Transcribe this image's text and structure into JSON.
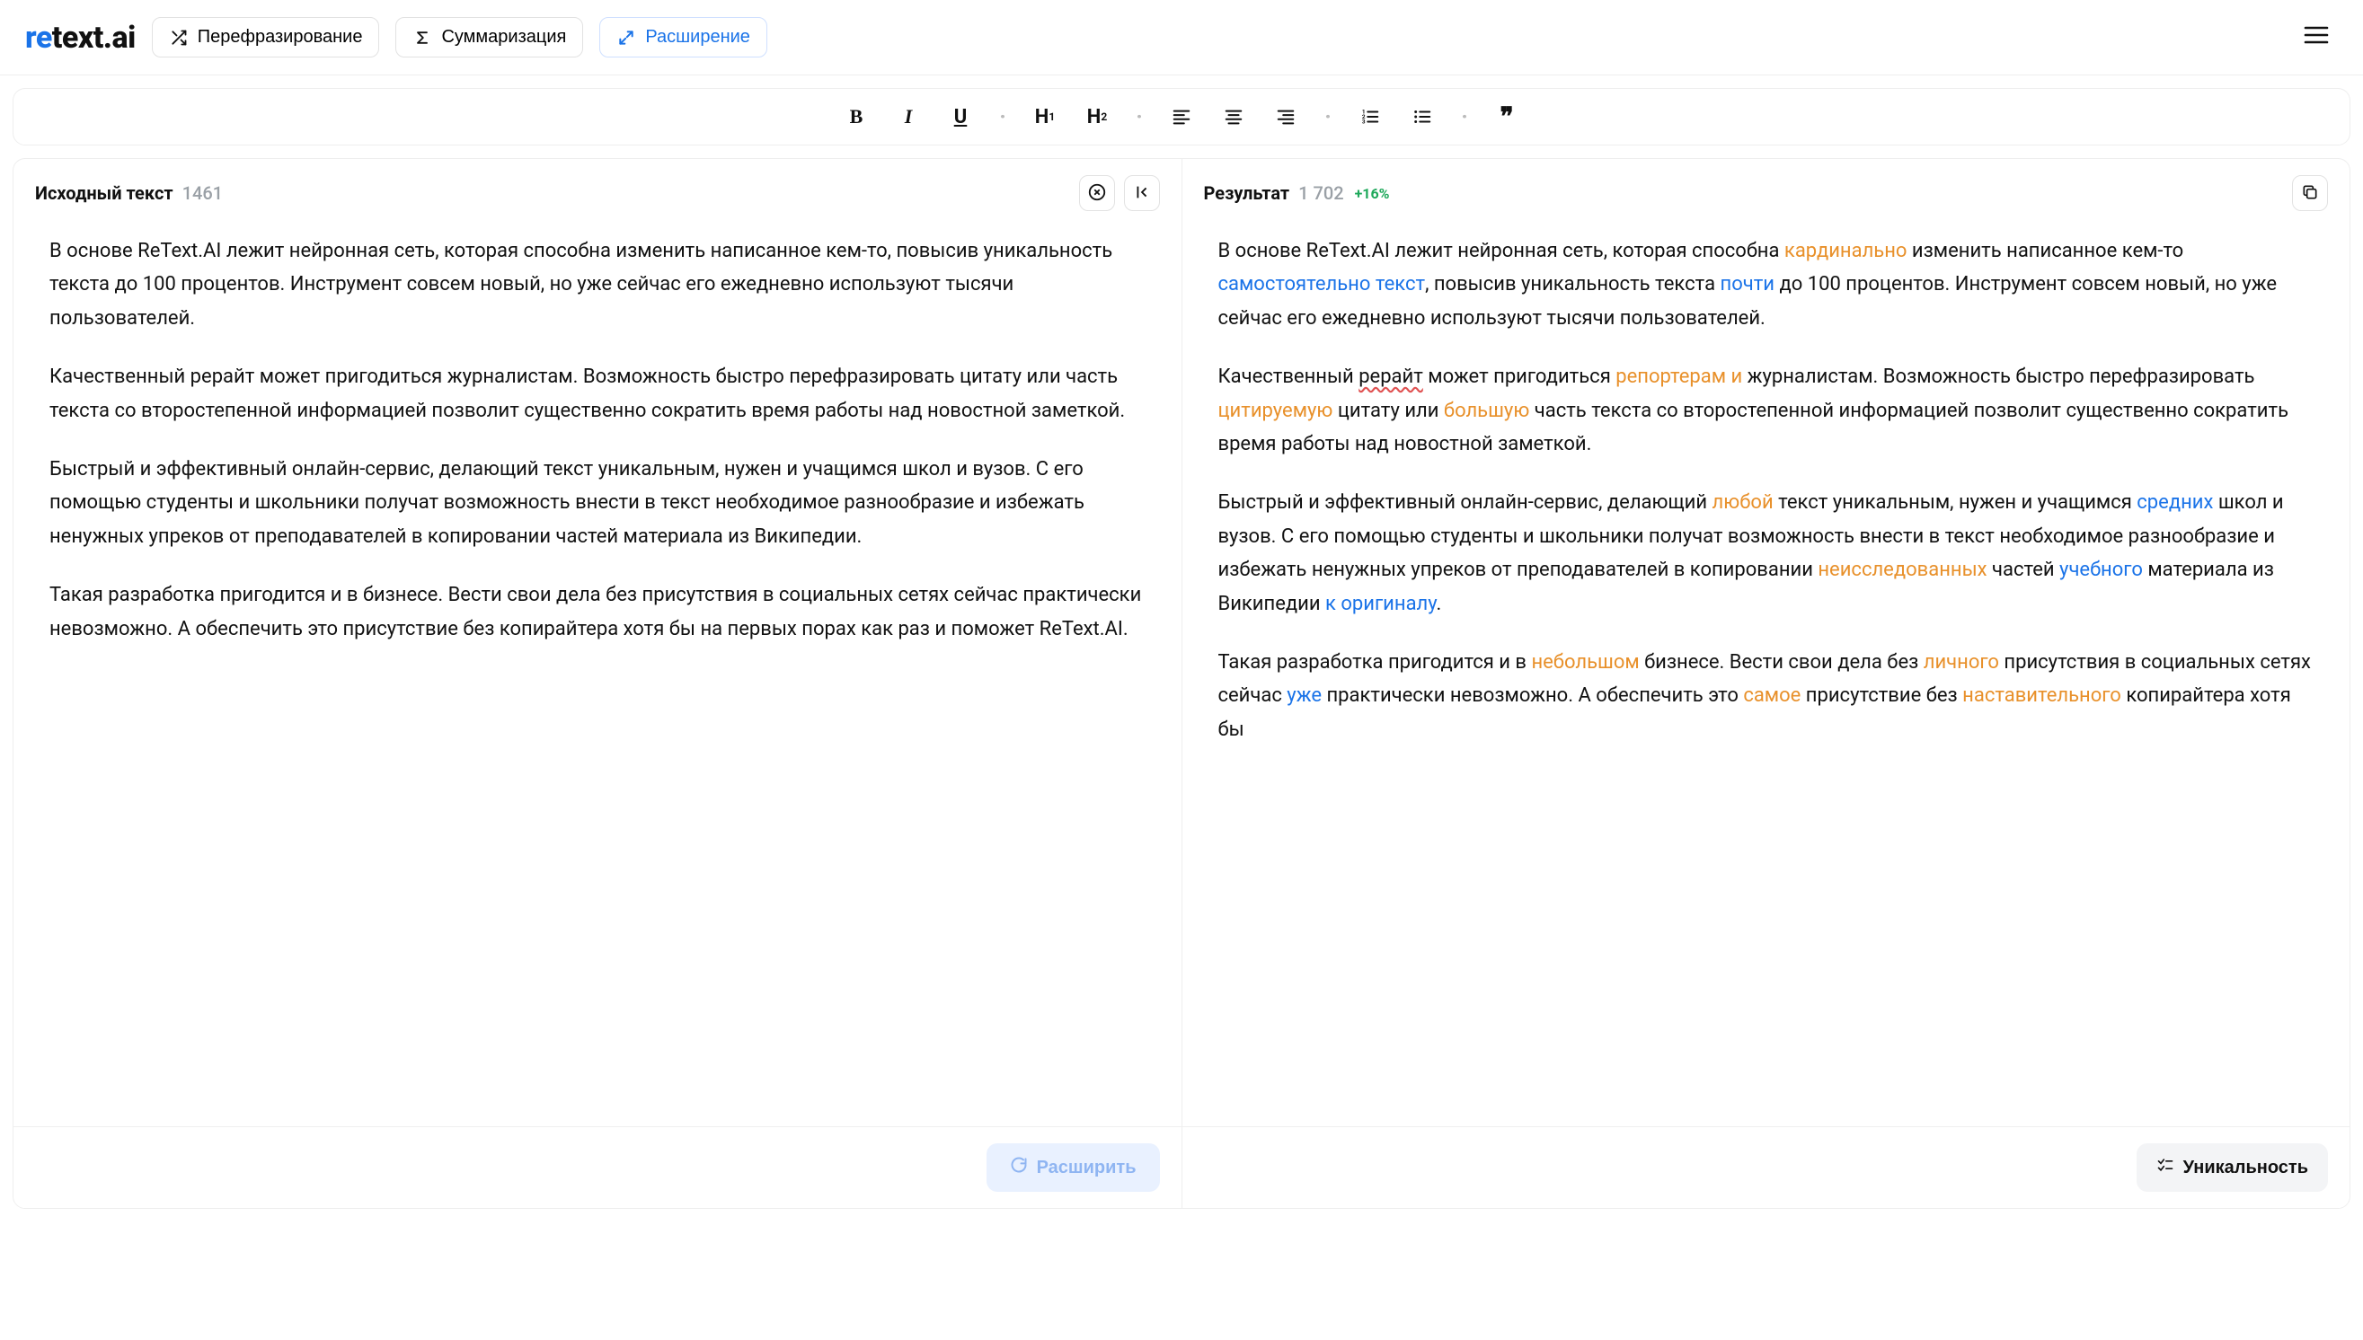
{
  "logo": {
    "prefix": "re",
    "suffix": "text.ai"
  },
  "modes": {
    "paraphrase": "Перефразирование",
    "summarize": "Суммаризация",
    "expand": "Расширение"
  },
  "source": {
    "title": "Исходный текст",
    "count": "1461",
    "paragraphs": [
      "В основе ReText.AI лежит нейронная сеть, которая способна изменить написанное кем-то, повысив уникальность текста до 100 процентов. Инструмент совсем новый, но уже сейчас его ежедневно используют тысячи пользователей.",
      "Качественный рерайт может пригодиться журналистам. Возможность быстро перефразировать цитату или часть текста со второстепенной информацией позволит существенно сократить время работы над новостной заметкой.",
      "Быстрый и эффективный онлайн-сервис, делающий текст уникальным, нужен и учащимся школ и вузов. С его помощью студенты и школьники получат возможность внести в текст необходимое разнообразие и избежать ненужных упреков от преподавателей в копировании частей материала из Википедии.",
      "Такая разработка пригодится и в бизнесе. Вести свои дела без присутствия в социальных сетях сейчас практически невозможно. А обеспечить это присутствие без копирайтера хотя бы на первых порах как раз и поможет ReText.AI."
    ],
    "action": "Расширить"
  },
  "result": {
    "title": "Результат",
    "count": "1 702",
    "delta": "+16%",
    "uniqueness_label": "Уникальность",
    "paragraphs": [
      [
        {
          "t": "В основе ReText.AI лежит нейронная сеть, которая способна "
        },
        {
          "t": "кардинально",
          "c": "o"
        },
        {
          "t": " изменить написанное кем-то "
        },
        {
          "t": "самостоятельно текст",
          "c": "b"
        },
        {
          "t": ", повысив уникальность текста "
        },
        {
          "t": "почти",
          "c": "b"
        },
        {
          "t": " до 100 процентов. Инструмент совсем новый, но уже сейчас его ежедневно используют тысячи пользователей."
        }
      ],
      [
        {
          "t": "Качественный "
        },
        {
          "t": "рерайт",
          "c": "sp"
        },
        {
          "t": " может пригодиться "
        },
        {
          "t": "репортерам и",
          "c": "o"
        },
        {
          "t": " журналистам. Возможность быстро перефразировать "
        },
        {
          "t": "цитируемую",
          "c": "o"
        },
        {
          "t": " цитату или "
        },
        {
          "t": "большую",
          "c": "o"
        },
        {
          "t": " часть текста со второстепенной информацией позволит существенно сократить время работы над новостной заметкой."
        }
      ],
      [
        {
          "t": "Быстрый и эффективный онлайн-сервис, делающий "
        },
        {
          "t": "любой",
          "c": "o"
        },
        {
          "t": " текст уникальным, нужен и учащимся "
        },
        {
          "t": "средних",
          "c": "b"
        },
        {
          "t": " школ и вузов. С его помощью студенты и школьники получат возможность внести в текст необходимое разнообразие и избежать ненужных упреков от преподавателей в копировании "
        },
        {
          "t": "неисследованных",
          "c": "o"
        },
        {
          "t": " частей "
        },
        {
          "t": "учебного",
          "c": "b"
        },
        {
          "t": " материала из Википедии "
        },
        {
          "t": "к оригиналу",
          "c": "b"
        },
        {
          "t": "."
        }
      ],
      [
        {
          "t": "Такая разработка пригодится и в "
        },
        {
          "t": "небольшом",
          "c": "o"
        },
        {
          "t": " бизнесе. Вести свои дела без "
        },
        {
          "t": "личного",
          "c": "o"
        },
        {
          "t": " присутствия в социальных сетях сейчас "
        },
        {
          "t": "уже",
          "c": "b"
        },
        {
          "t": " практически невозможно. А обеспечить это "
        },
        {
          "t": "самое",
          "c": "o"
        },
        {
          "t": " присутствие без "
        },
        {
          "t": "наставительного",
          "c": "o"
        },
        {
          "t": " копирайтера хотя бы"
        }
      ]
    ]
  }
}
